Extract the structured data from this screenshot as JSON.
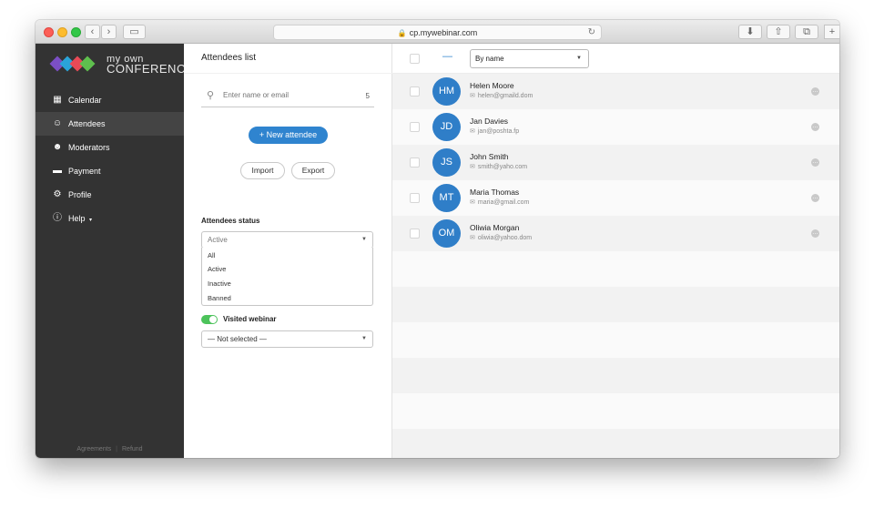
{
  "browser": {
    "url": "cp.mywebinar.com",
    "icons": [
      "back-icon",
      "forward-icon",
      "sidebar-toggle-icon",
      "lock-icon",
      "reload-icon",
      "download-icon",
      "share-icon",
      "tabs-icon",
      "new-tab-icon"
    ]
  },
  "logo": {
    "line1": "my own",
    "line2": "CONFERENCE",
    "colors": [
      "#7b4fc4",
      "#2aa4d9",
      "#e84a57",
      "#5fbf4e"
    ]
  },
  "sidebar": {
    "items": [
      {
        "label": "Calendar",
        "icon": "calendar-icon",
        "active": false
      },
      {
        "label": "Attendees",
        "icon": "attendees-icon",
        "active": true
      },
      {
        "label": "Moderators",
        "icon": "moderators-icon",
        "active": false
      },
      {
        "label": "Payment",
        "icon": "card-icon",
        "active": false
      },
      {
        "label": "Profile",
        "icon": "gear-icon",
        "active": false
      },
      {
        "label": "Help",
        "icon": "info-icon",
        "active": false
      }
    ],
    "footer": {
      "agreements": "Agreements",
      "sep": "|",
      "refund": "Refund"
    }
  },
  "filter": {
    "title": "Attendees list",
    "search": {
      "placeholder": "Enter name or email",
      "count": "5"
    },
    "new_button": "+ New attendee",
    "import_button": "Import",
    "export_button": "Export",
    "status_label": "Attendees status",
    "status_selected": "Active",
    "status_options": [
      "All",
      "Active",
      "Inactive",
      "Banned"
    ],
    "visited_label": "Visited webinar",
    "visited_on": true,
    "webinar_select": "— Not selected —"
  },
  "list": {
    "sort_label": "By name",
    "attendees": [
      {
        "initials": "HM",
        "name": "Helen Moore",
        "email": "helen@gmaild.dom"
      },
      {
        "initials": "JD",
        "name": "Jan Davies",
        "email": "jan@poshta.fp"
      },
      {
        "initials": "JS",
        "name": "John Smith",
        "email": "smith@yaho.com"
      },
      {
        "initials": "MT",
        "name": "Maria Thomas",
        "email": "maria@gmail.com"
      },
      {
        "initials": "OM",
        "name": "Oliwia Morgan",
        "email": "oliwia@yahoo.dom"
      }
    ]
  },
  "colors": {
    "accent": "#2f84cf",
    "avatar": "#2f7ec8",
    "sidebar": "#333333",
    "toggle": "#4cc35b"
  }
}
